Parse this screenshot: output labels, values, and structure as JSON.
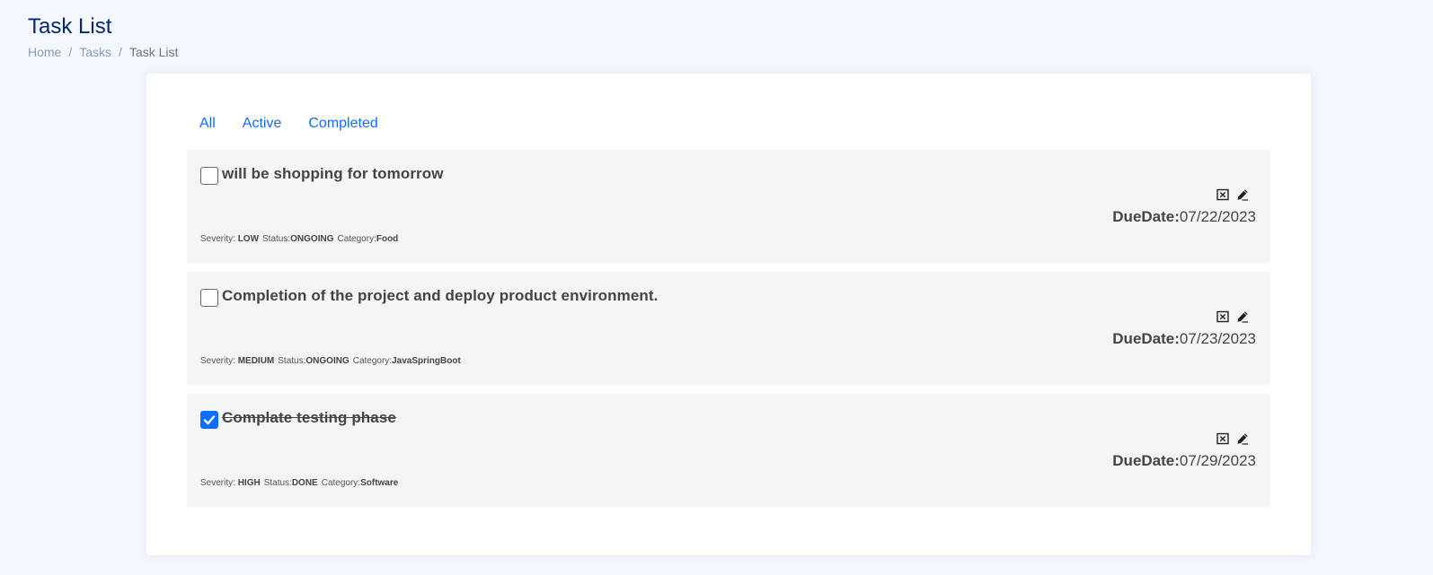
{
  "header": {
    "title": "Task List",
    "breadcrumb": [
      "Home",
      "Tasks",
      "Task List"
    ],
    "separator": "/"
  },
  "tabs": [
    "All",
    "Active",
    "Completed"
  ],
  "labels": {
    "due": "DueDate:",
    "severity": "Severity:",
    "status": "Status:",
    "category": "Category:"
  },
  "tasks": [
    {
      "title": "will be shopping for tomorrow",
      "checked": false,
      "due_date": "07/22/2023",
      "severity": "LOW",
      "status": "ONGOING",
      "category": "Food"
    },
    {
      "title": "Completion of the project and deploy product environment.",
      "checked": false,
      "due_date": "07/23/2023",
      "severity": "MEDIUM",
      "status": "ONGOING",
      "category": "JavaSpringBoot"
    },
    {
      "title": "Complate testing phase",
      "checked": true,
      "due_date": "07/29/2023",
      "severity": "HIGH",
      "status": "DONE",
      "category": "Software"
    }
  ],
  "icons": {
    "delete": "delete-icon",
    "edit": "pencil-icon",
    "check": "check-icon"
  },
  "colors": {
    "accent": "#0d6efd",
    "title": "#012970",
    "breadcrumb": "#899bbd",
    "task_bg": "#f5f5f5",
    "page_bg": "#f4f7fd"
  }
}
